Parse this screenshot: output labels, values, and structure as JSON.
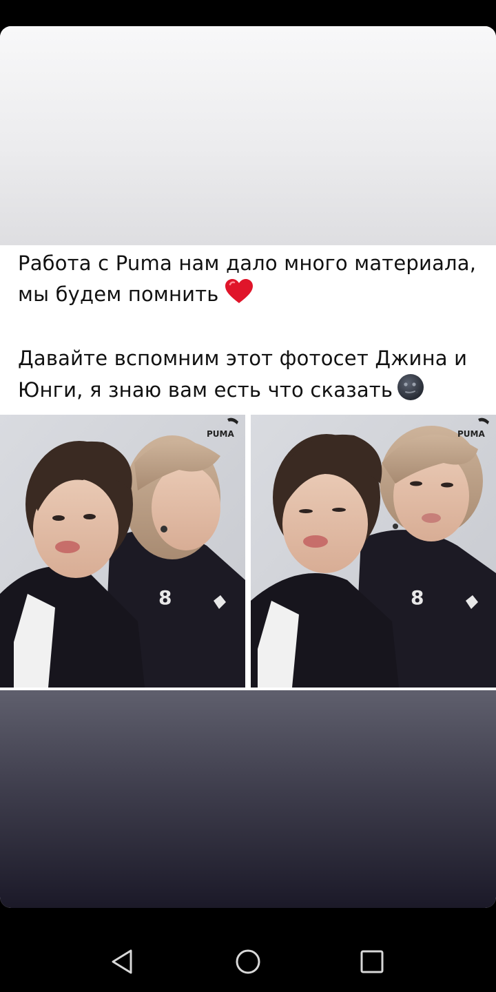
{
  "post": {
    "paragraph_1": "Работа с Puma нам дало много материала, мы будем помнить",
    "paragraph_1_emoji": "red-heart-emoji",
    "paragraph_2": "Давайте вспомним этот фотосет Джина и Юнги, я знаю вам есть что сказать",
    "paragraph_2_emoji": "new-moon-face-emoji"
  },
  "photos": [
    {
      "brand_logo": "PUMA"
    },
    {
      "brand_logo": "PUMA"
    }
  ],
  "navigation": {
    "icons": [
      "back-triangle-icon",
      "home-circle-icon",
      "recents-square-icon"
    ]
  },
  "colors": {
    "background": "#000000",
    "card": "#ffffff",
    "text": "#111111",
    "heart": "#e0152a"
  }
}
